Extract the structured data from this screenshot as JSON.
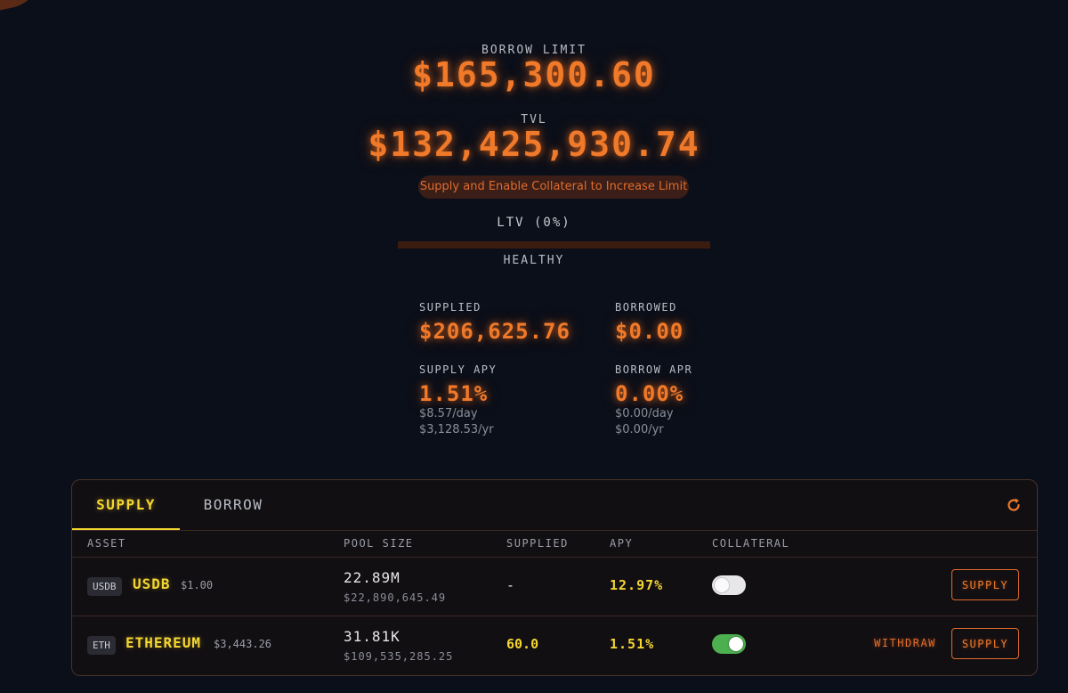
{
  "summary": {
    "borrow_limit_label": "BORROW LIMIT",
    "borrow_limit_value": "$165,300.60",
    "tvl_label": "TVL",
    "tvl_value": "$132,425,930.74",
    "hint": "Supply and Enable Collateral to Increase Limit",
    "ltv_label": "LTV (0%)",
    "ltv_fraction": 0,
    "health_label": "HEALTHY"
  },
  "stats": {
    "supplied_label": "SUPPLIED",
    "supplied_value": "$206,625.76",
    "borrowed_label": "BORROWED",
    "borrowed_value": "$0.00",
    "supply_apy_label": "SUPPLY APY",
    "supply_apy_value": "1.51%",
    "supply_apy_day": "$8.57/day",
    "supply_apy_year": "$3,128.53/yr",
    "borrow_apr_label": "BORROW APR",
    "borrow_apr_value": "0.00%",
    "borrow_apr_day": "$0.00/day",
    "borrow_apr_year": "$0.00/yr"
  },
  "tabs": {
    "supply": "SUPPLY",
    "borrow": "BORROW",
    "active": "supply"
  },
  "table": {
    "headers": {
      "asset": "ASSET",
      "pool_size": "POOL SIZE",
      "supplied": "SUPPLIED",
      "apy": "APY",
      "collateral": "COLLATERAL"
    },
    "rows": [
      {
        "badge": "USDB",
        "name": "USDB",
        "price": "$1.00",
        "pool_size": "22.89M",
        "pool_size_usd": "$22,890,645.49",
        "supplied": "-",
        "apy": "12.97%",
        "collateral": false,
        "supply_label": "SUPPLY"
      },
      {
        "badge": "ETH",
        "name": "ETHEREUM",
        "price": "$3,443.26",
        "pool_size": "31.81K",
        "pool_size_usd": "$109,535,285.25",
        "supplied": "60.0",
        "apy": "1.51%",
        "collateral": true,
        "withdraw_label": "WITHDRAW",
        "supply_label": "SUPPLY"
      }
    ]
  },
  "colors": {
    "background": "#0b0f19",
    "accent_orange": "#f07a2a",
    "accent_yellow": "#f5d631",
    "toggle_on": "#4caf50"
  },
  "icons": {
    "refresh": "refresh-icon"
  }
}
